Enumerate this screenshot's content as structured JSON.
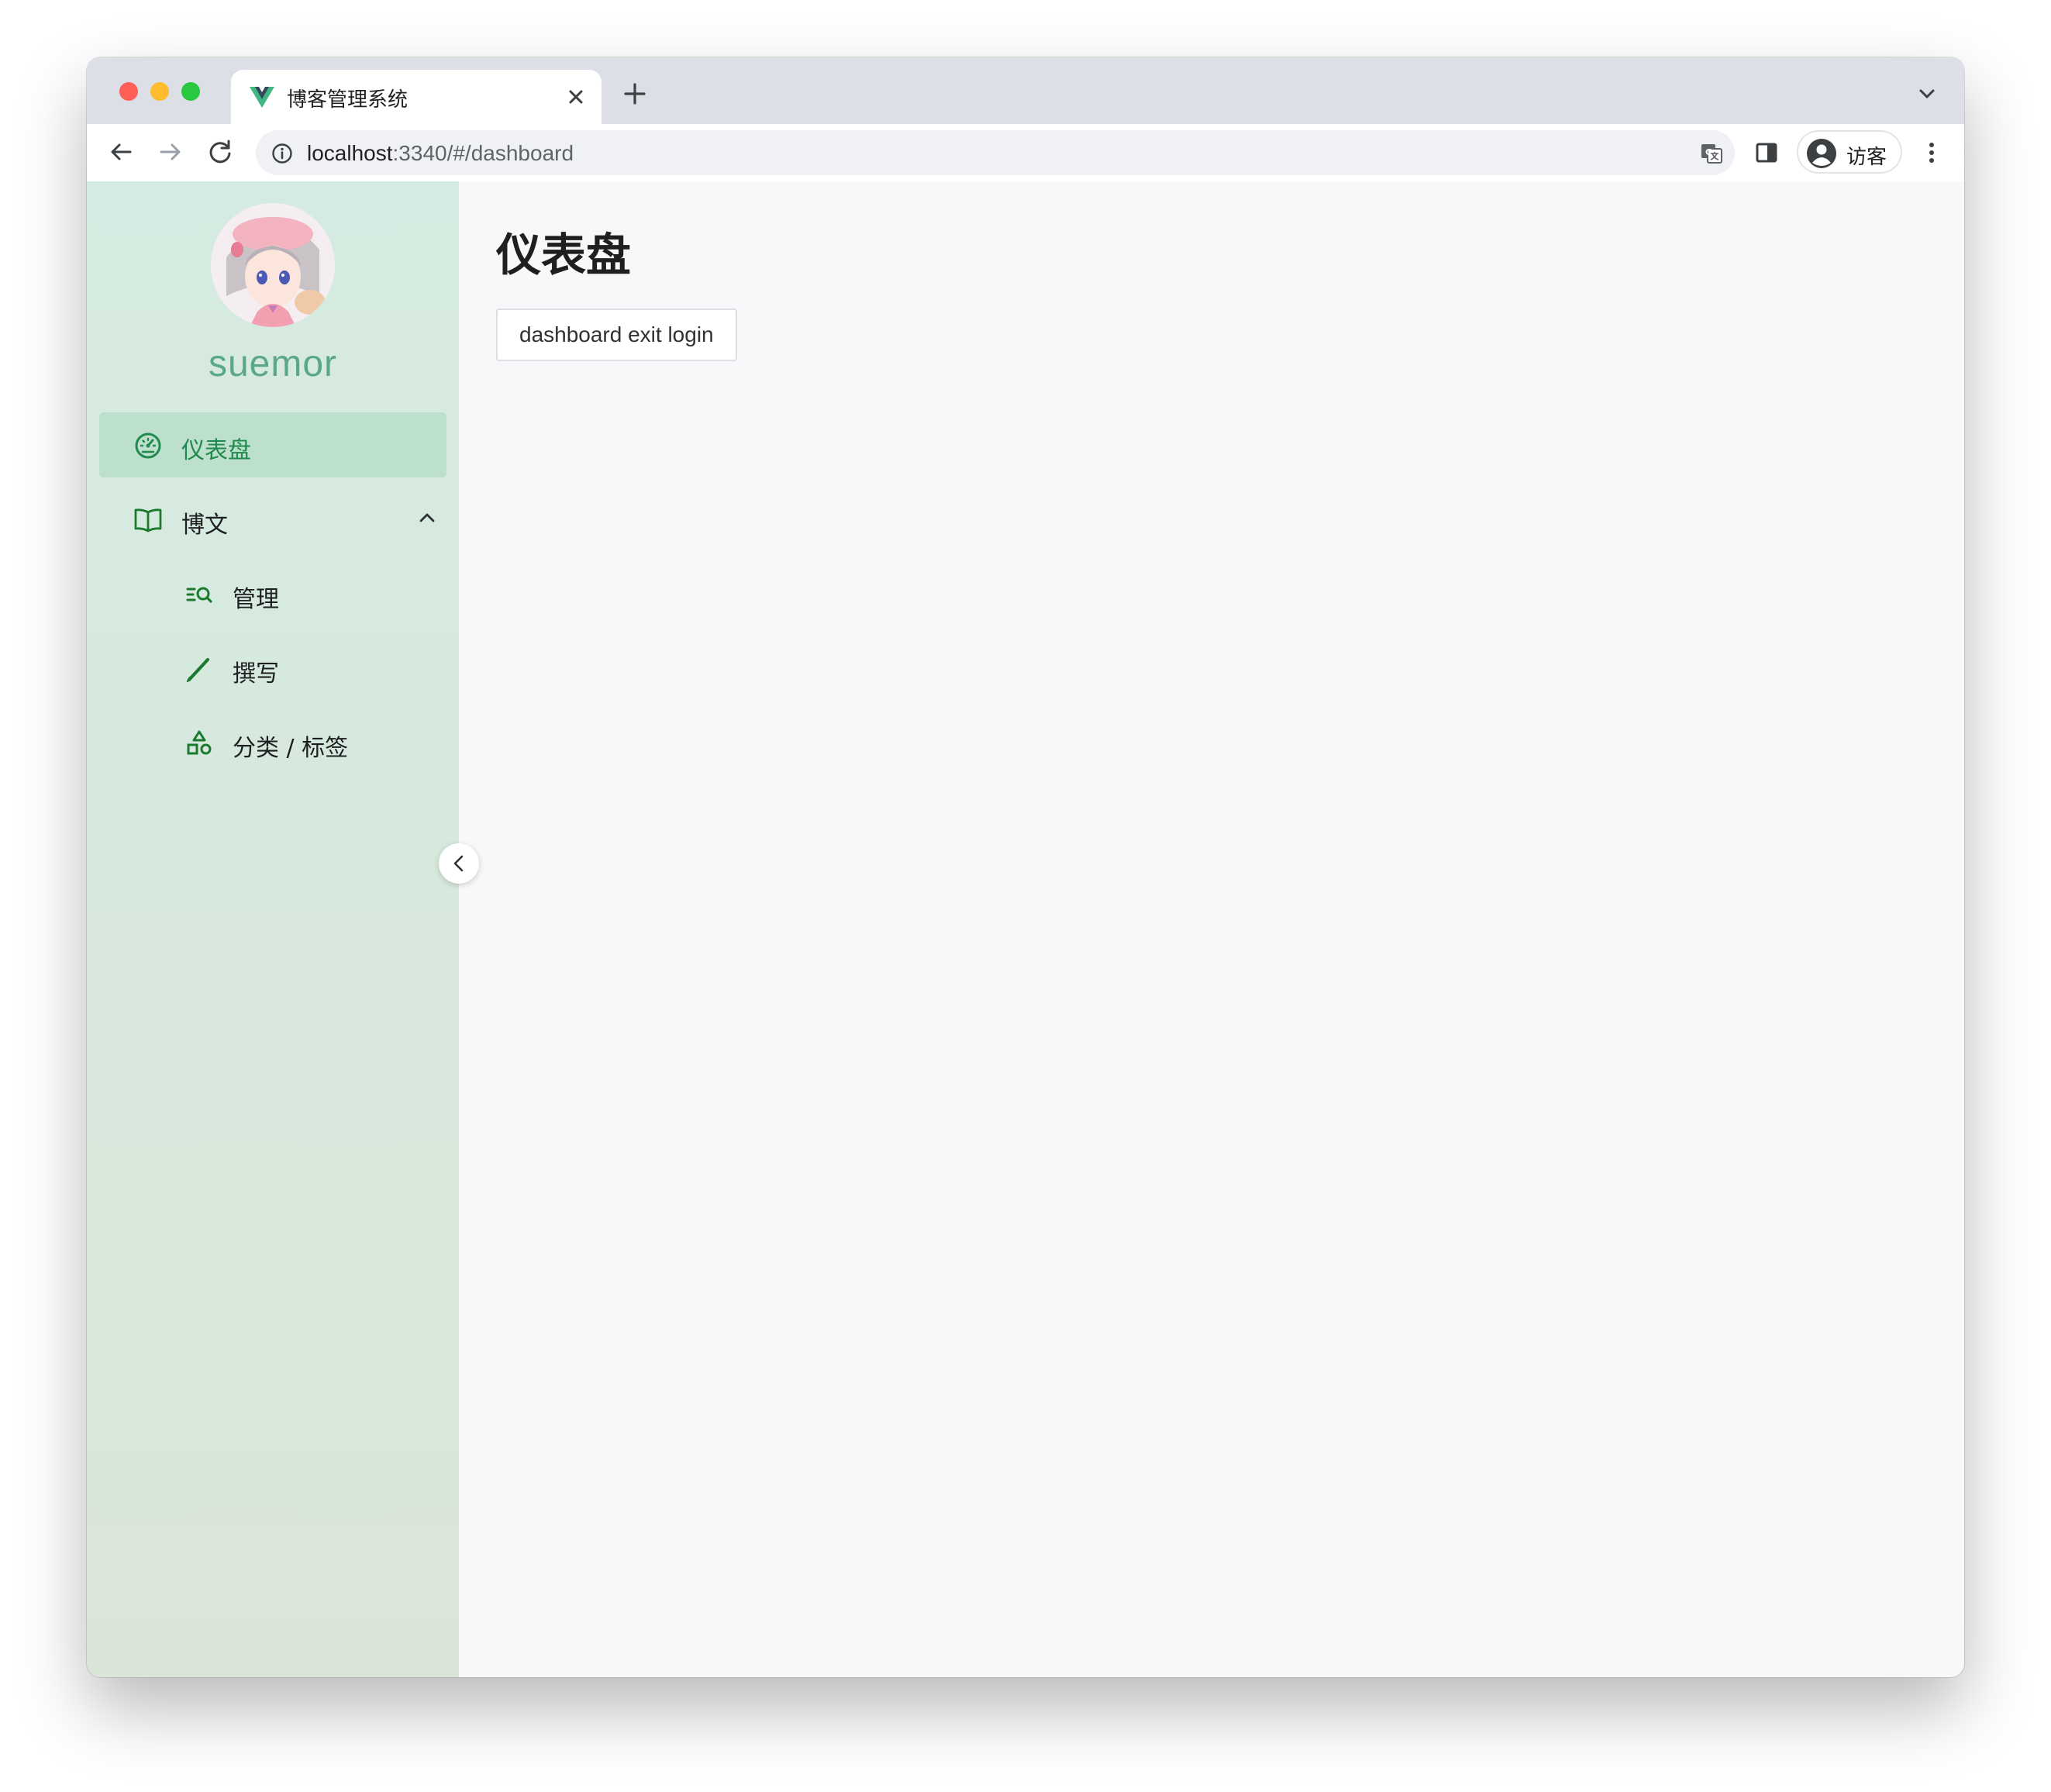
{
  "browser": {
    "tab_title": "博客管理系统",
    "url_host": "localhost",
    "url_rest": ":3340/#/dashboard",
    "profile_label": "访客"
  },
  "sidebar": {
    "brand": "suemor",
    "items": [
      {
        "label": "仪表盘",
        "icon": "dashboard-gauge-icon",
        "active": true
      },
      {
        "label": "博文",
        "icon": "book-icon",
        "expanded": true
      },
      {
        "label": "管理",
        "icon": "list-search-icon"
      },
      {
        "label": "撰写",
        "icon": "pencil-icon"
      },
      {
        "label": "分类 / 标签",
        "icon": "shapes-icon"
      }
    ]
  },
  "main": {
    "title": "仪表盘",
    "exit_button": "dashboard exit login"
  },
  "colors": {
    "sidebar_bg": "#d5ebe1",
    "active_item_bg": "#bde0cd",
    "active_text": "#1f8a4c",
    "brand_text": "#5aa885",
    "icon_green": "#1b7a2e"
  }
}
